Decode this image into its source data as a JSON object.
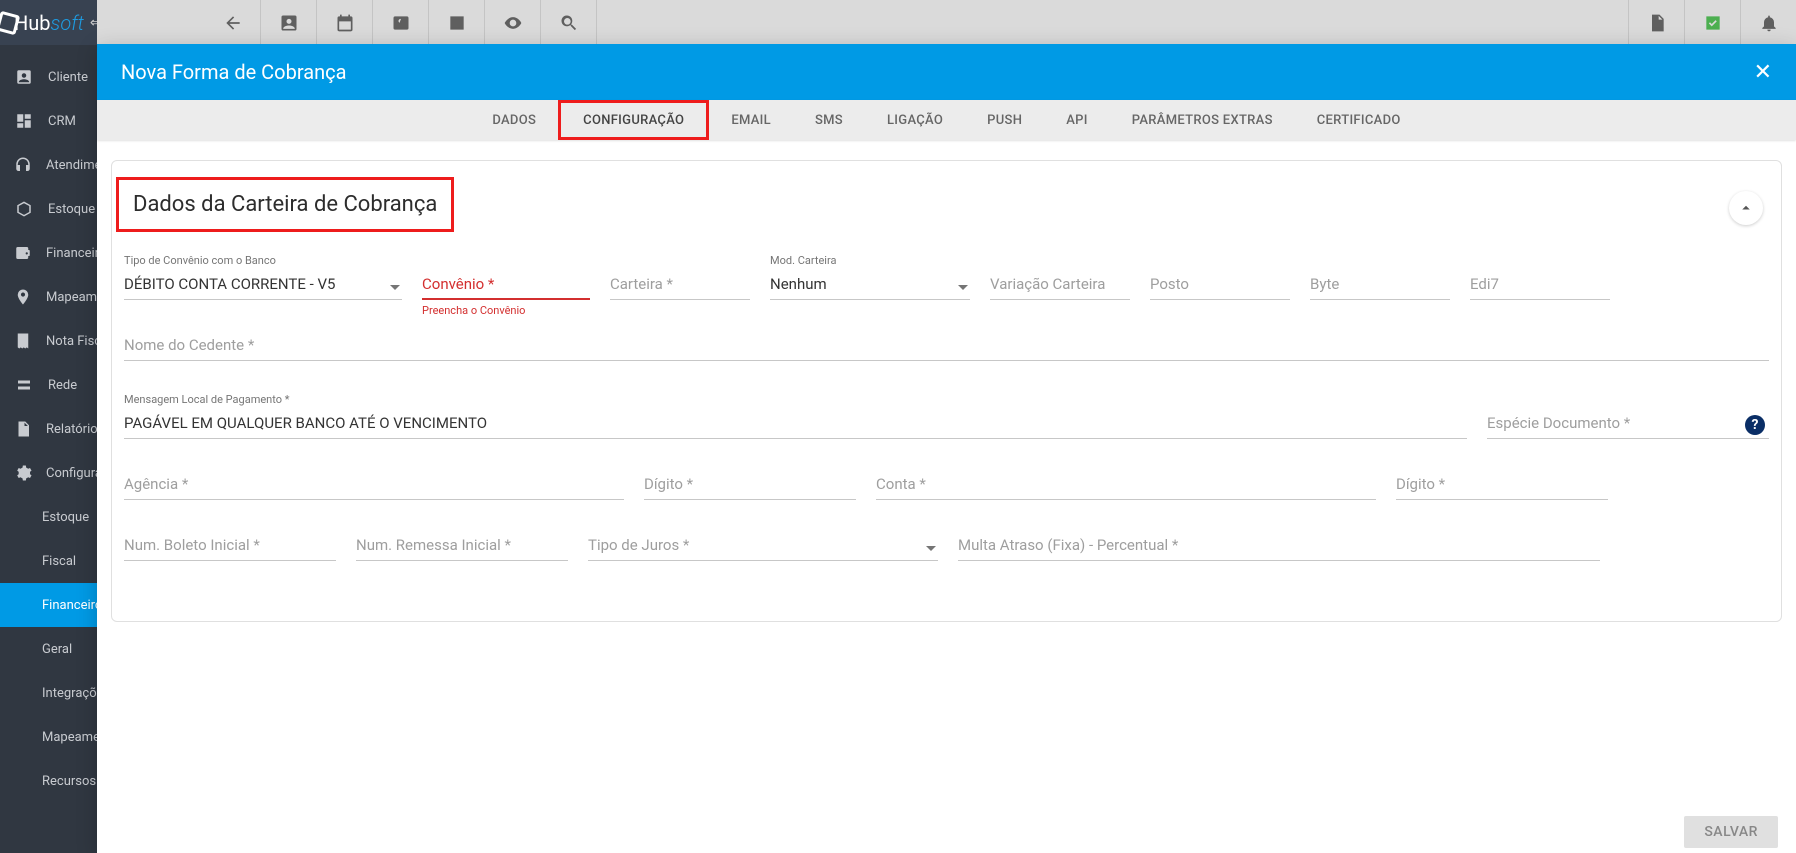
{
  "app": {
    "brand_a": "Hub",
    "brand_b": "soft"
  },
  "sidebar": {
    "items": [
      {
        "label": "Cliente"
      },
      {
        "label": "CRM"
      },
      {
        "label": "Atendimento"
      },
      {
        "label": "Estoque"
      },
      {
        "label": "Financeiro"
      },
      {
        "label": "Mapeamento"
      },
      {
        "label": "Nota Fiscal"
      },
      {
        "label": "Rede"
      },
      {
        "label": "Relatórios"
      },
      {
        "label": "Configurações"
      }
    ],
    "sub": [
      {
        "label": "Estoque"
      },
      {
        "label": "Fiscal"
      },
      {
        "label": "Financeiro"
      },
      {
        "label": "Geral"
      },
      {
        "label": "Integrações"
      },
      {
        "label": "Mapeamento"
      },
      {
        "label": "Recursos Humanos"
      }
    ]
  },
  "dialog": {
    "title": "Nova Forma de Cobrança",
    "tabs": [
      "DADOS",
      "CONFIGURAÇÃO",
      "EMAIL",
      "SMS",
      "LIGAÇÃO",
      "PUSH",
      "API",
      "PARÂMETROS EXTRAS",
      "CERTIFICADO"
    ],
    "section_title": "Dados da Carteira de Cobrança",
    "footer_save": "SALVAR"
  },
  "form": {
    "tipo_convenio_label": "Tipo de Convênio com o Banco",
    "tipo_convenio_value": "DÉBITO CONTA CORRENTE - V5",
    "convenio_label": "Convênio *",
    "convenio_helper": "Preencha o Convênio",
    "carteira_label": "Carteira *",
    "mod_carteira_label": "Mod. Carteira",
    "mod_carteira_value": "Nenhum",
    "variacao_label": "Variação Carteira",
    "posto_label": "Posto",
    "byte_label": "Byte",
    "edi7_label": "Edi7",
    "nome_cedente_label": "Nome do Cedente *",
    "msg_local_label": "Mensagem Local de Pagamento *",
    "msg_local_value": "PAGÁVEL EM QUALQUER BANCO ATÉ O VENCIMENTO",
    "especie_label": "Espécie Documento *",
    "agencia_label": "Agência *",
    "digito1_label": "Dígito *",
    "conta_label": "Conta *",
    "digito2_label": "Dígito *",
    "num_boleto_label": "Num. Boleto Inicial *",
    "num_remessa_label": "Num. Remessa Inicial *",
    "tipo_juros_label": "Tipo de Juros *",
    "multa_label": "Multa Atraso (Fixa) - Percentual *"
  }
}
